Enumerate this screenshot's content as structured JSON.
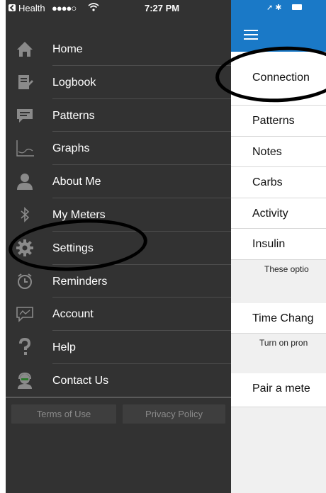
{
  "status_bar": {
    "carrier": "Health",
    "signal": "●●●●○",
    "wifi_icon": "wifi-icon",
    "time": "7:27 PM"
  },
  "drawer": {
    "items": [
      {
        "label": "Home",
        "icon": "home-icon"
      },
      {
        "label": "Logbook",
        "icon": "logbook-icon"
      },
      {
        "label": "Patterns",
        "icon": "chat-icon"
      },
      {
        "label": "Graphs",
        "icon": "graph-icon"
      },
      {
        "label": "About Me",
        "icon": "person-icon"
      },
      {
        "label": "My Meters",
        "icon": "bluetooth-icon"
      },
      {
        "label": "Settings",
        "icon": "gear-icon"
      },
      {
        "label": "Reminders",
        "icon": "clock-icon"
      },
      {
        "label": "Account",
        "icon": "account-icon"
      },
      {
        "label": "Help",
        "icon": "question-icon"
      },
      {
        "label": "Contact Us",
        "icon": "headset-icon"
      }
    ],
    "footer": {
      "terms": "Terms of Use",
      "privacy": "Privacy Policy"
    }
  },
  "right_panel": {
    "list": {
      "connections": "Connection",
      "patterns": "Patterns",
      "notes": "Notes",
      "carbs": "Carbs",
      "activity": "Activity",
      "insulin": "Insulin",
      "note_1": "These optio",
      "time_change": "Time Chang",
      "note_2": "Turn on pron",
      "pair_meter": "Pair a mete"
    }
  },
  "colors": {
    "drawer_bg": "#323232",
    "topbar_blue": "#1a79c7",
    "right_bg": "#f0f0f0"
  }
}
